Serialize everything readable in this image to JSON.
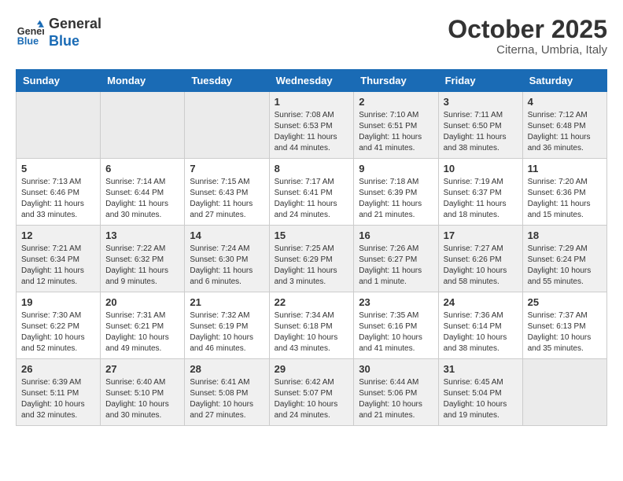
{
  "header": {
    "logo_line1": "General",
    "logo_line2": "Blue",
    "month": "October 2025",
    "location": "Citerna, Umbria, Italy"
  },
  "weekdays": [
    "Sunday",
    "Monday",
    "Tuesday",
    "Wednesday",
    "Thursday",
    "Friday",
    "Saturday"
  ],
  "weeks": [
    [
      {
        "day": "",
        "info": ""
      },
      {
        "day": "",
        "info": ""
      },
      {
        "day": "",
        "info": ""
      },
      {
        "day": "1",
        "info": "Sunrise: 7:08 AM\nSunset: 6:53 PM\nDaylight: 11 hours and 44 minutes."
      },
      {
        "day": "2",
        "info": "Sunrise: 7:10 AM\nSunset: 6:51 PM\nDaylight: 11 hours and 41 minutes."
      },
      {
        "day": "3",
        "info": "Sunrise: 7:11 AM\nSunset: 6:50 PM\nDaylight: 11 hours and 38 minutes."
      },
      {
        "day": "4",
        "info": "Sunrise: 7:12 AM\nSunset: 6:48 PM\nDaylight: 11 hours and 36 minutes."
      }
    ],
    [
      {
        "day": "5",
        "info": "Sunrise: 7:13 AM\nSunset: 6:46 PM\nDaylight: 11 hours and 33 minutes."
      },
      {
        "day": "6",
        "info": "Sunrise: 7:14 AM\nSunset: 6:44 PM\nDaylight: 11 hours and 30 minutes."
      },
      {
        "day": "7",
        "info": "Sunrise: 7:15 AM\nSunset: 6:43 PM\nDaylight: 11 hours and 27 minutes."
      },
      {
        "day": "8",
        "info": "Sunrise: 7:17 AM\nSunset: 6:41 PM\nDaylight: 11 hours and 24 minutes."
      },
      {
        "day": "9",
        "info": "Sunrise: 7:18 AM\nSunset: 6:39 PM\nDaylight: 11 hours and 21 minutes."
      },
      {
        "day": "10",
        "info": "Sunrise: 7:19 AM\nSunset: 6:37 PM\nDaylight: 11 hours and 18 minutes."
      },
      {
        "day": "11",
        "info": "Sunrise: 7:20 AM\nSunset: 6:36 PM\nDaylight: 11 hours and 15 minutes."
      }
    ],
    [
      {
        "day": "12",
        "info": "Sunrise: 7:21 AM\nSunset: 6:34 PM\nDaylight: 11 hours and 12 minutes."
      },
      {
        "day": "13",
        "info": "Sunrise: 7:22 AM\nSunset: 6:32 PM\nDaylight: 11 hours and 9 minutes."
      },
      {
        "day": "14",
        "info": "Sunrise: 7:24 AM\nSunset: 6:30 PM\nDaylight: 11 hours and 6 minutes."
      },
      {
        "day": "15",
        "info": "Sunrise: 7:25 AM\nSunset: 6:29 PM\nDaylight: 11 hours and 3 minutes."
      },
      {
        "day": "16",
        "info": "Sunrise: 7:26 AM\nSunset: 6:27 PM\nDaylight: 11 hours and 1 minute."
      },
      {
        "day": "17",
        "info": "Sunrise: 7:27 AM\nSunset: 6:26 PM\nDaylight: 10 hours and 58 minutes."
      },
      {
        "day": "18",
        "info": "Sunrise: 7:29 AM\nSunset: 6:24 PM\nDaylight: 10 hours and 55 minutes."
      }
    ],
    [
      {
        "day": "19",
        "info": "Sunrise: 7:30 AM\nSunset: 6:22 PM\nDaylight: 10 hours and 52 minutes."
      },
      {
        "day": "20",
        "info": "Sunrise: 7:31 AM\nSunset: 6:21 PM\nDaylight: 10 hours and 49 minutes."
      },
      {
        "day": "21",
        "info": "Sunrise: 7:32 AM\nSunset: 6:19 PM\nDaylight: 10 hours and 46 minutes."
      },
      {
        "day": "22",
        "info": "Sunrise: 7:34 AM\nSunset: 6:18 PM\nDaylight: 10 hours and 43 minutes."
      },
      {
        "day": "23",
        "info": "Sunrise: 7:35 AM\nSunset: 6:16 PM\nDaylight: 10 hours and 41 minutes."
      },
      {
        "day": "24",
        "info": "Sunrise: 7:36 AM\nSunset: 6:14 PM\nDaylight: 10 hours and 38 minutes."
      },
      {
        "day": "25",
        "info": "Sunrise: 7:37 AM\nSunset: 6:13 PM\nDaylight: 10 hours and 35 minutes."
      }
    ],
    [
      {
        "day": "26",
        "info": "Sunrise: 6:39 AM\nSunset: 5:11 PM\nDaylight: 10 hours and 32 minutes."
      },
      {
        "day": "27",
        "info": "Sunrise: 6:40 AM\nSunset: 5:10 PM\nDaylight: 10 hours and 30 minutes."
      },
      {
        "day": "28",
        "info": "Sunrise: 6:41 AM\nSunset: 5:08 PM\nDaylight: 10 hours and 27 minutes."
      },
      {
        "day": "29",
        "info": "Sunrise: 6:42 AM\nSunset: 5:07 PM\nDaylight: 10 hours and 24 minutes."
      },
      {
        "day": "30",
        "info": "Sunrise: 6:44 AM\nSunset: 5:06 PM\nDaylight: 10 hours and 21 minutes."
      },
      {
        "day": "31",
        "info": "Sunrise: 6:45 AM\nSunset: 5:04 PM\nDaylight: 10 hours and 19 minutes."
      },
      {
        "day": "",
        "info": ""
      }
    ]
  ]
}
